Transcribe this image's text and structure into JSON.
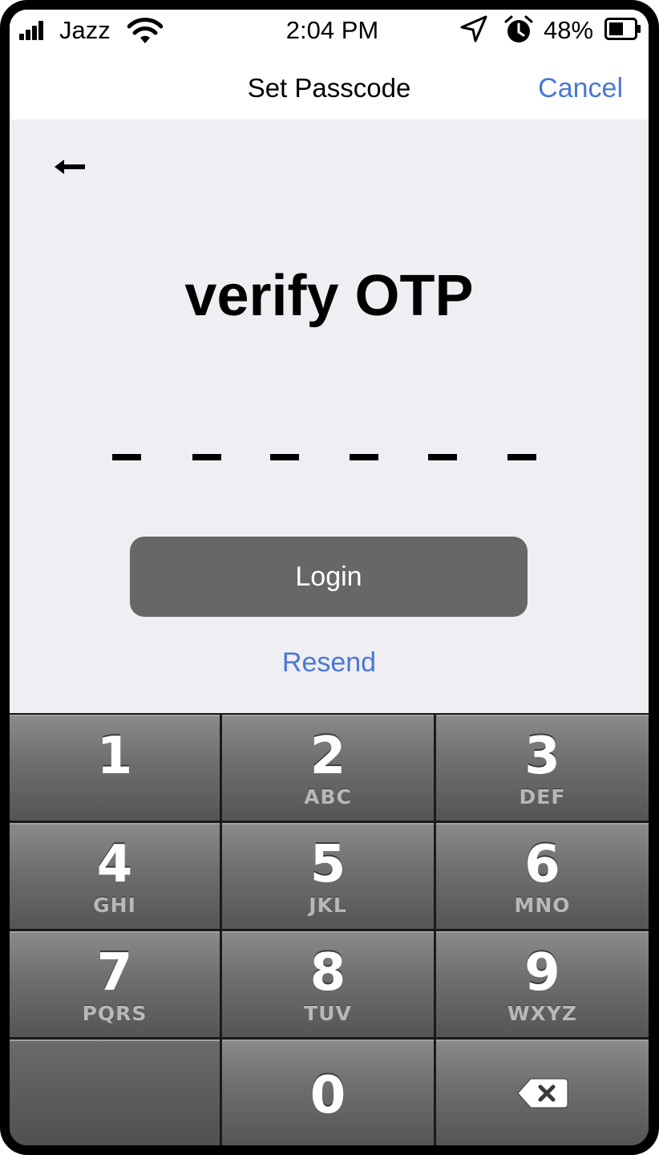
{
  "status_bar": {
    "carrier": "Jazz",
    "time": "2:04 PM",
    "battery_percent": "48%",
    "icons": [
      "signal-bars-icon",
      "wifi-icon",
      "location-arrow-icon",
      "alarm-clock-icon",
      "battery-icon"
    ]
  },
  "nav": {
    "title": "Set Passcode",
    "cancel_label": "Cancel"
  },
  "content": {
    "back_icon": "back-arrow-icon",
    "title": "verify OTP",
    "otp_length": 6,
    "login_label": "Login",
    "resend_label": "Resend"
  },
  "keypad": {
    "keys": [
      {
        "digit": "1",
        "letters": ""
      },
      {
        "digit": "2",
        "letters": "ABC"
      },
      {
        "digit": "3",
        "letters": "DEF"
      },
      {
        "digit": "4",
        "letters": "GHI"
      },
      {
        "digit": "5",
        "letters": "JKL"
      },
      {
        "digit": "6",
        "letters": "MNO"
      },
      {
        "digit": "7",
        "letters": "PQRS"
      },
      {
        "digit": "8",
        "letters": "TUV"
      },
      {
        "digit": "9",
        "letters": "WXYZ"
      },
      {
        "digit": "0",
        "letters": ""
      }
    ],
    "delete_icon": "backspace-icon"
  },
  "colors": {
    "accent": "#4a77d4",
    "button": "#676767",
    "background": "#efeef3"
  }
}
